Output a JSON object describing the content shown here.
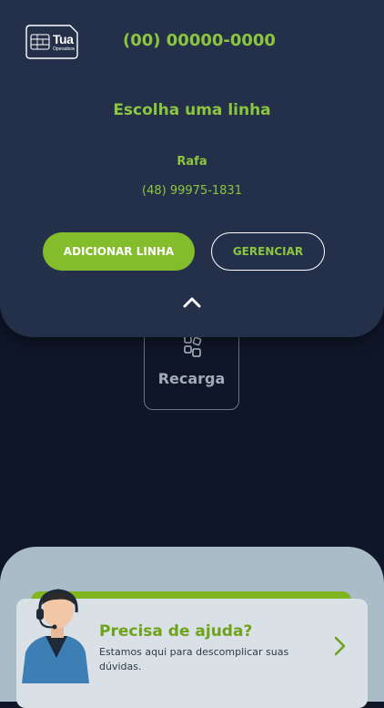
{
  "header": {
    "logo": {
      "name": "Tua",
      "subtitle": "Operadora"
    },
    "phone_number": "(00) 00000-0000"
  },
  "sheet": {
    "title": "Escolha uma linha",
    "line": {
      "name": "Rafa",
      "number": "(48) 99975-1831"
    },
    "add_button": "ADICIONAR LINHA",
    "manage_button": "GERENCIAR"
  },
  "tiles": [
    {
      "label": "Recarga",
      "icon": "recharge-icon"
    }
  ],
  "help": {
    "title": "Precisa de ajuda?",
    "description": "Estamos aqui para descomplicar suas dúvidas."
  },
  "colors": {
    "brand_green": "#8cc63f",
    "sheet_bg": "#243049",
    "page_bg": "#0f1628",
    "help_panel_bg": "#a9bcc8"
  }
}
